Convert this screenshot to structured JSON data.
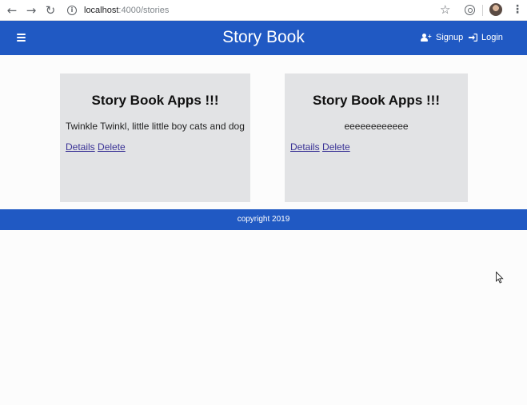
{
  "browser": {
    "url_host": "localhost",
    "url_path": ":4000/stories"
  },
  "header": {
    "title": "Story Book",
    "signup_label": "Signup",
    "login_label": "Login"
  },
  "stories": [
    {
      "title": "Story Book Apps !!!",
      "body": "Twinkle Twinkl, little little boy cats and dog",
      "details_label": "Details",
      "delete_label": "Delete"
    },
    {
      "title": "Story Book Apps !!!",
      "body": "eeeeeeeeeeee",
      "details_label": "Details",
      "delete_label": "Delete"
    }
  ],
  "footer": {
    "text": "copyright 2019"
  },
  "colors": {
    "primary": "#2059c3",
    "card_bg": "#e2e3e5",
    "link": "#3a3396"
  },
  "icons": {
    "menu": "hamburger-icon",
    "signup": "user-plus-icon",
    "login": "sign-in-icon"
  }
}
